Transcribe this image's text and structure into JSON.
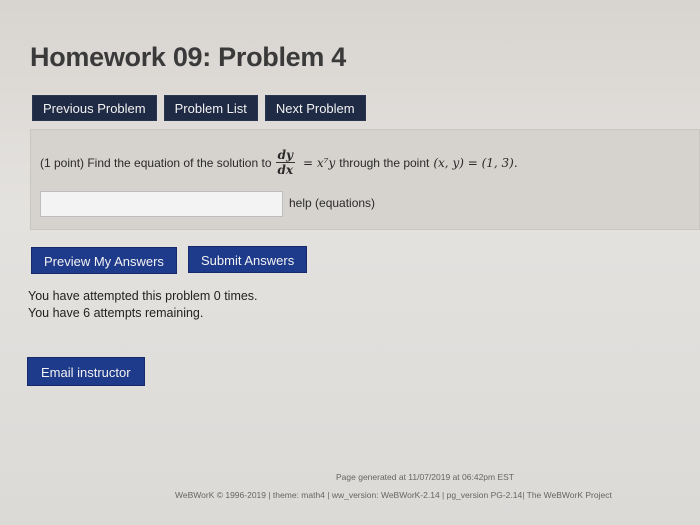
{
  "page_title": "Homework 09: Problem 4",
  "nav": {
    "previous": "Previous Problem",
    "list": "Problem List",
    "next": "Next Problem"
  },
  "problem": {
    "prefix": "(1 point) Find the equation of the solution to",
    "frac_num": "dy",
    "frac_den": "dx",
    "rhs": "= x⁷y",
    "suffix": "through the point",
    "point": "(x, y) = (1, 3)."
  },
  "answer": {
    "value": "",
    "help": "help (equations)"
  },
  "buttons": {
    "preview": "Preview My Answers",
    "submit": "Submit Answers",
    "email": "Email instructor"
  },
  "attempts": {
    "line1": "You have attempted this problem 0 times.",
    "line2": "You have 6 attempts remaining."
  },
  "footer": {
    "generated": "Page generated at 11/07/2019 at 06:42pm EST",
    "credits": "WeBWorK © 1996-2019 | theme: math4 | ww_version: WeBWorK-2.14 | pg_version PG-2.14| The WeBWorK Project"
  }
}
